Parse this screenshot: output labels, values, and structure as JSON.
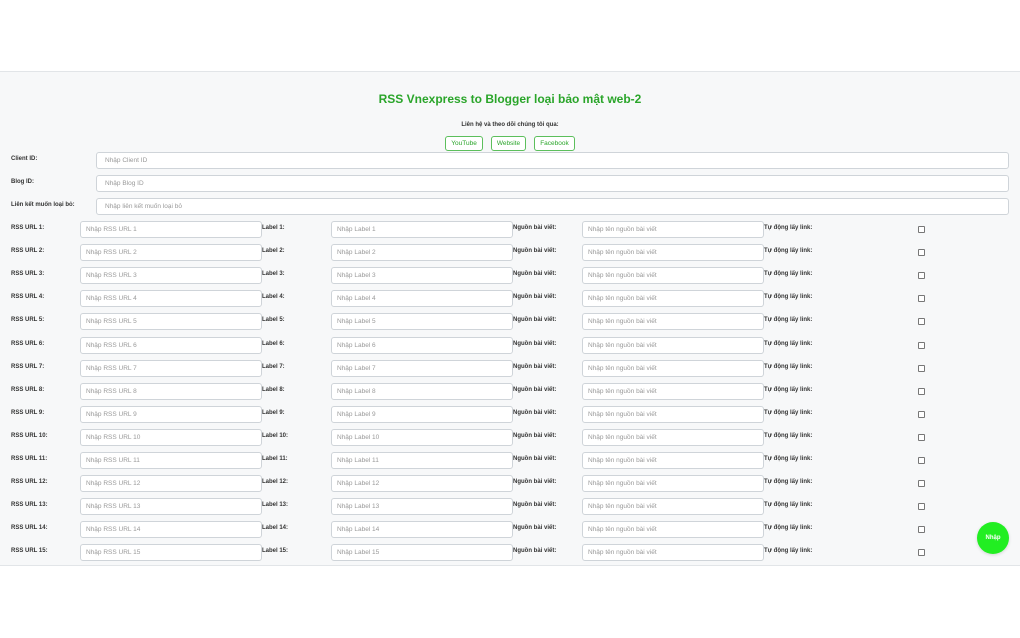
{
  "header": {
    "title": "RSS Vnexpress to Blogger loại bảo mật web-2",
    "contact_text": "Liên hệ và theo dõi chúng tôi qua:",
    "links": [
      "YouTube",
      "Website",
      "Facebook"
    ]
  },
  "config": [
    {
      "label": "Client ID:",
      "placeholder": "Nhập Client ID"
    },
    {
      "label": "Blog ID:",
      "placeholder": "Nhập Blog ID"
    },
    {
      "label": "Liên kết muốn loại bỏ:",
      "placeholder": "Nhập liên kết muốn loại bỏ"
    }
  ],
  "rss_rows": [
    {
      "rss_label": "RSS URL 1:",
      "rss_placeholder": "Nhập RSS URL 1",
      "label_label": "Label 1:",
      "label_placeholder": "Nhập Label 1",
      "source_label": "Nguồn bài viết:",
      "source_placeholder": "Nhập tên nguồn bài viết",
      "auto_label": "Tự động lấy link:",
      "auto_checked": false
    },
    {
      "rss_label": "RSS URL 2:",
      "rss_placeholder": "Nhập RSS URL 2",
      "label_label": "Label 2:",
      "label_placeholder": "Nhập Label 2",
      "source_label": "Nguồn bài viết:",
      "source_placeholder": "Nhập tên nguồn bài viết",
      "auto_label": "Tự động lấy link:",
      "auto_checked": false
    },
    {
      "rss_label": "RSS URL 3:",
      "rss_placeholder": "Nhập RSS URL 3",
      "label_label": "Label 3:",
      "label_placeholder": "Nhập Label 3",
      "source_label": "Nguồn bài viết:",
      "source_placeholder": "Nhập tên nguồn bài viết",
      "auto_label": "Tự động lấy link:",
      "auto_checked": false
    },
    {
      "rss_label": "RSS URL 4:",
      "rss_placeholder": "Nhập RSS URL 4",
      "label_label": "Label 4:",
      "label_placeholder": "Nhập Label 4",
      "source_label": "Nguồn bài viết:",
      "source_placeholder": "Nhập tên nguồn bài viết",
      "auto_label": "Tự động lấy link:",
      "auto_checked": false
    },
    {
      "rss_label": "RSS URL 5:",
      "rss_placeholder": "Nhập RSS URL 5",
      "label_label": "Label 5:",
      "label_placeholder": "Nhập Label 5",
      "source_label": "Nguồn bài viết:",
      "source_placeholder": "Nhập tên nguồn bài viết",
      "auto_label": "Tự động lấy link:",
      "auto_checked": false
    },
    {
      "rss_label": "RSS URL 6:",
      "rss_placeholder": "Nhập RSS URL 6",
      "label_label": "Label 6:",
      "label_placeholder": "Nhập Label 6",
      "source_label": "Nguồn bài viết:",
      "source_placeholder": "Nhập tên nguồn bài viết",
      "auto_label": "Tự động lấy link:",
      "auto_checked": false
    },
    {
      "rss_label": "RSS URL 7:",
      "rss_placeholder": "Nhập RSS URL 7",
      "label_label": "Label 7:",
      "label_placeholder": "Nhập Label 7",
      "source_label": "Nguồn bài viết:",
      "source_placeholder": "Nhập tên nguồn bài viết",
      "auto_label": "Tự động lấy link:",
      "auto_checked": false
    },
    {
      "rss_label": "RSS URL 8:",
      "rss_placeholder": "Nhập RSS URL 8",
      "label_label": "Label 8:",
      "label_placeholder": "Nhập Label 8",
      "source_label": "Nguồn bài viết:",
      "source_placeholder": "Nhập tên nguồn bài viết",
      "auto_label": "Tự động lấy link:",
      "auto_checked": false
    },
    {
      "rss_label": "RSS URL 9:",
      "rss_placeholder": "Nhập RSS URL 9",
      "label_label": "Label 9:",
      "label_placeholder": "Nhập Label 9",
      "source_label": "Nguồn bài viết:",
      "source_placeholder": "Nhập tên nguồn bài viết",
      "auto_label": "Tự động lấy link:",
      "auto_checked": false
    },
    {
      "rss_label": "RSS URL 10:",
      "rss_placeholder": "Nhập RSS URL 10",
      "label_label": "Label 10:",
      "label_placeholder": "Nhập Label 10",
      "source_label": "Nguồn bài viết:",
      "source_placeholder": "Nhập tên nguồn bài viết",
      "auto_label": "Tự động lấy link:",
      "auto_checked": false
    },
    {
      "rss_label": "RSS URL 11:",
      "rss_placeholder": "Nhập RSS URL 11",
      "label_label": "Label 11:",
      "label_placeholder": "Nhập Label 11",
      "source_label": "Nguồn bài viết:",
      "source_placeholder": "Nhập tên nguồn bài viết",
      "auto_label": "Tự động lấy link:",
      "auto_checked": false
    },
    {
      "rss_label": "RSS URL 12:",
      "rss_placeholder": "Nhập RSS URL 12",
      "label_label": "Label 12:",
      "label_placeholder": "Nhập Label 12",
      "source_label": "Nguồn bài viết:",
      "source_placeholder": "Nhập tên nguồn bài viết",
      "auto_label": "Tự động lấy link:",
      "auto_checked": false
    },
    {
      "rss_label": "RSS URL 13:",
      "rss_placeholder": "Nhập RSS URL 13",
      "label_label": "Label 13:",
      "label_placeholder": "Nhập Label 13",
      "source_label": "Nguồn bài viết:",
      "source_placeholder": "Nhập tên nguồn bài viết",
      "auto_label": "Tự động lấy link:",
      "auto_checked": false
    },
    {
      "rss_label": "RSS URL 14:",
      "rss_placeholder": "Nhập RSS URL 14",
      "label_label": "Label 14:",
      "label_placeholder": "Nhập Label 14",
      "source_label": "Nguồn bài viết:",
      "source_placeholder": "Nhập tên nguồn bài viết",
      "auto_label": "Tự động lấy link:",
      "auto_checked": false
    },
    {
      "rss_label": "RSS URL 15:",
      "rss_placeholder": "Nhập RSS URL 15",
      "label_label": "Label 15:",
      "label_placeholder": "Nhập Label 15",
      "source_label": "Nguồn bài viết:",
      "source_placeholder": "Nhập tên nguồn bài viết",
      "auto_label": "Tự động lấy link:",
      "auto_checked": false
    }
  ],
  "submit_label": "Nhập",
  "colors": {
    "accent": "#2aa52a",
    "submit": "#22ee22",
    "panel_bg": "#f7f8f9"
  }
}
